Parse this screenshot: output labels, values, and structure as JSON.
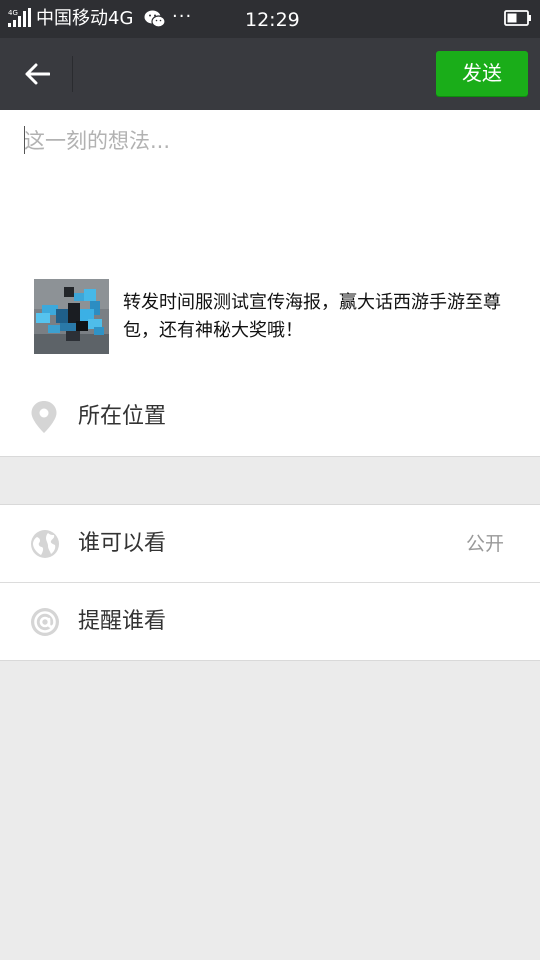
{
  "status_bar": {
    "network_badge": "4G",
    "carrier": "中国移动4G",
    "more": "···",
    "time": "12:29"
  },
  "title_bar": {
    "back_icon": "arrow-left-icon",
    "send_label": "发送"
  },
  "composer": {
    "placeholder": "这一刻的想法...",
    "value": ""
  },
  "share_card": {
    "text": "转发时间服测试宣传海报，赢大话西游手游至尊包，还有神秘大奖哦！"
  },
  "location": {
    "icon": "location-pin-icon",
    "label": "所在位置"
  },
  "visibility": {
    "icon": "globe-icon",
    "label": "谁可以看",
    "value": "公开"
  },
  "mention": {
    "icon": "at-sign-icon",
    "label": "提醒谁看"
  },
  "colors": {
    "accent": "#1aad19",
    "status_bar": "#2e2f33",
    "title_bar": "#393a3f",
    "page_bg": "#ebebeb"
  }
}
